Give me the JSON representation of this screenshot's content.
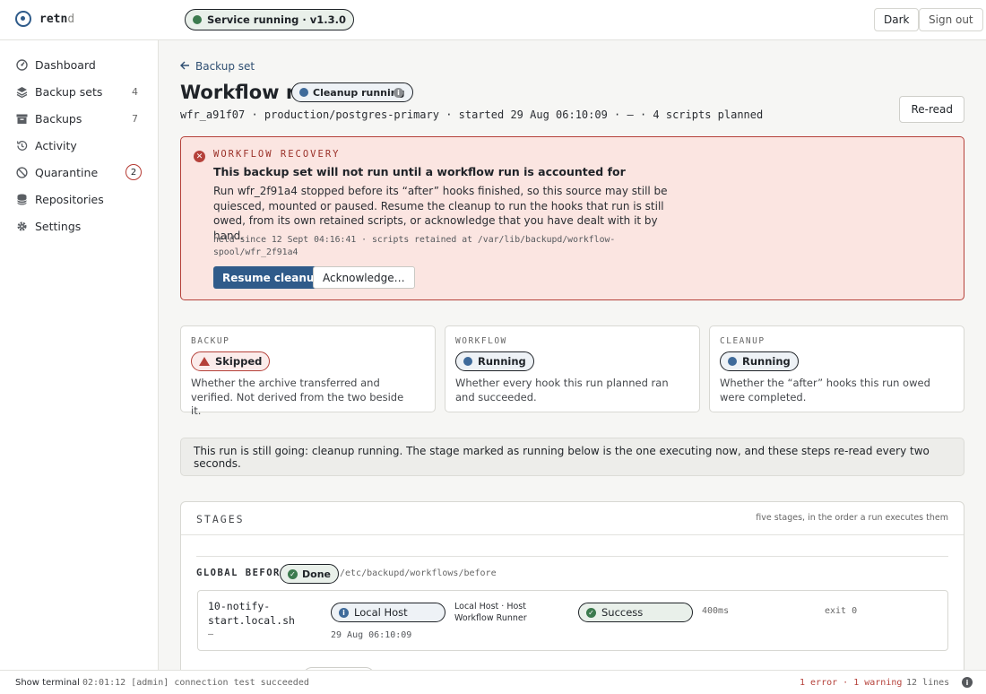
{
  "app": {
    "logo_bold": "retn",
    "logo_light": "d"
  },
  "service": {
    "status_label": "Service running · v1.3.0",
    "status_color": "#3c7a4e"
  },
  "topbar": {
    "theme_label": "Dark",
    "signout_label": "Sign out"
  },
  "sidebar": {
    "items": [
      {
        "label": "Dashboard",
        "icon": "dashboard-icon",
        "count": ""
      },
      {
        "label": "Backup sets",
        "icon": "layers-icon",
        "count": "4"
      },
      {
        "label": "Backups",
        "icon": "archive-icon",
        "count": "7"
      },
      {
        "label": "Activity",
        "icon": "history-icon",
        "count": ""
      },
      {
        "label": "Quarantine",
        "icon": "ban-icon",
        "count": "2"
      },
      {
        "label": "Repositories",
        "icon": "database-icon",
        "count": ""
      },
      {
        "label": "Settings",
        "icon": "gear-icon",
        "count": ""
      }
    ]
  },
  "page": {
    "back_label": "Backup set",
    "title": "Workflow run",
    "status_pill": "Cleanup running",
    "subline": "wfr_a91f07 · production/postgres-primary · started 29 Aug 06:10:09 · — · 4 scripts planned",
    "reread_label": "Re-read"
  },
  "alert": {
    "tag": "WORKFLOW RECOVERY",
    "headline": "This backup set will not run until a workflow run is accounted for",
    "body": "Run wfr_2f91a4 stopped before its “after” hooks finished, so this source may still be quiesced, mounted or paused. Resume the cleanup to run the hooks that run is still owed, from its own retained scripts, or acknowledge that you have dealt with it by hand.",
    "meta": "held since 12 Sept 04:16:41 · scripts retained at /var/lib/backupd/workflow-spool/wfr_2f91a4",
    "resume_label": "Resume cleanup",
    "ack_label": "Acknowledge…",
    "accent_color": "#b5413a"
  },
  "cards": [
    {
      "tag": "BACKUP",
      "status": "Skipped",
      "desc": "Whether the archive transferred and verified. Not derived from the two beside it."
    },
    {
      "tag": "WORKFLOW",
      "status": "Running",
      "desc": "Whether every hook this run planned ran and succeeded."
    },
    {
      "tag": "CLEANUP",
      "status": "Running",
      "desc": "Whether the “after” hooks this run owed were completed."
    }
  ],
  "notice": "This run is still going: cleanup running. The stage marked as running below is the one executing now, and these steps re-read every two seconds.",
  "stages": {
    "header": "STAGES",
    "note": "five stages, in the order a run executes them",
    "stage": {
      "name": "GLOBAL BEFORE",
      "status": "Done",
      "path": "/etc/backupd/workflows/before",
      "script": {
        "name": "10-notify-start.local.sh",
        "dash": "—",
        "host_label": "Local Host",
        "host_desc": "Local Host · Host Workflow Runner",
        "result": "Success",
        "duration": "400ms",
        "exit": "exit 0",
        "timestamp": "29 Aug 06:10:09"
      }
    }
  },
  "statusbar": {
    "terminal_label": "Show terminal",
    "last_log": "02:01:12 [admin] connection test succeeded",
    "errors": "1 error · 1 warning",
    "lines": "12 lines"
  }
}
